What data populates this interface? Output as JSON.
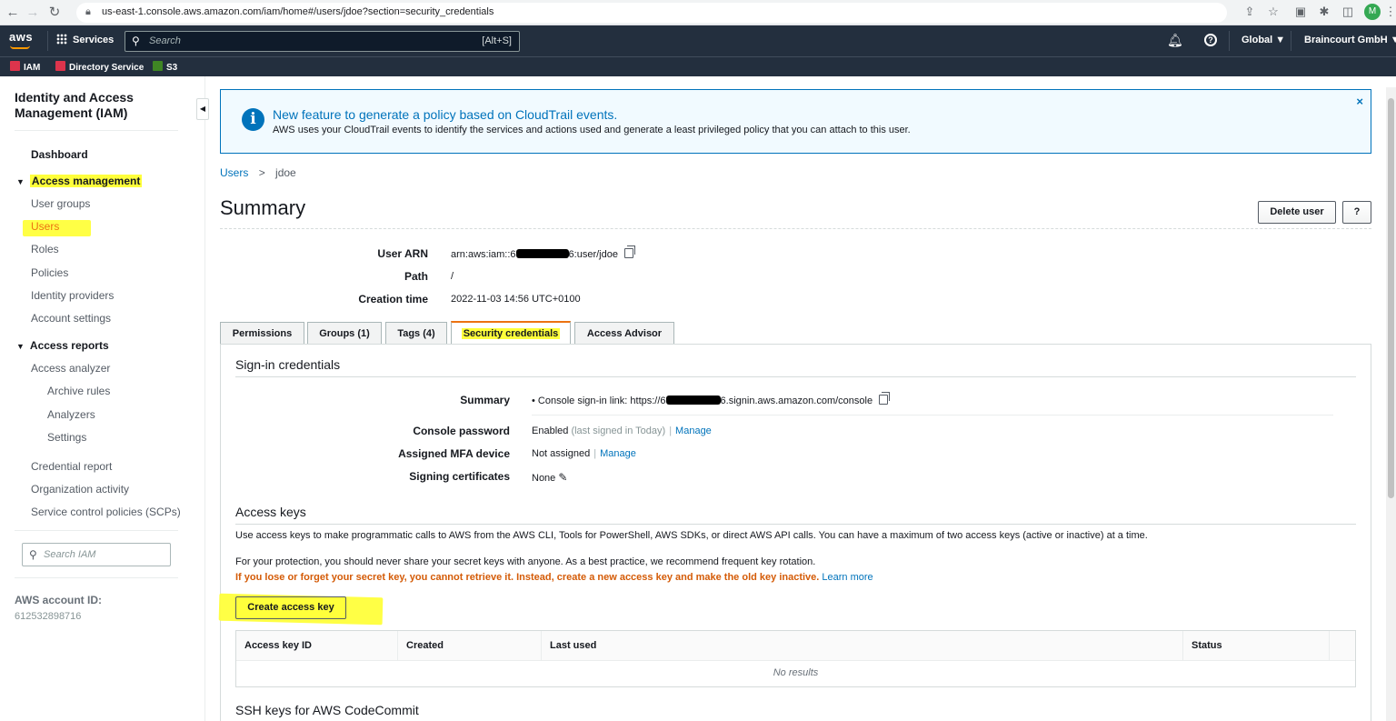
{
  "browser": {
    "url": "us-east-1.console.aws.amazon.com/iam/home#/users/jdoe?section=security_credentials",
    "profile_initial": "M"
  },
  "topnav": {
    "logo": "aws",
    "services": "Services",
    "search_placeholder": "Search",
    "search_shortcut": "[Alt+S]",
    "region": "Global ▼",
    "account": "Braincourt GmbH ▼"
  },
  "favorites": [
    {
      "label": "IAM",
      "color": "#dd344c"
    },
    {
      "label": "Directory Service",
      "color": "#dd344c"
    },
    {
      "label": "S3",
      "color": "#3f8624"
    }
  ],
  "sidebar": {
    "title": "Identity and Access Management (IAM)",
    "dashboard": "Dashboard",
    "access_management": "Access management",
    "access_items": [
      "User groups",
      "Users",
      "Roles",
      "Policies",
      "Identity providers",
      "Account settings"
    ],
    "access_reports": "Access reports",
    "access_analyzer": "Access analyzer",
    "analyzer_items": [
      "Archive rules",
      "Analyzers",
      "Settings"
    ],
    "report_items": [
      "Credential report",
      "Organization activity",
      "Service control policies (SCPs)"
    ],
    "search_placeholder": "Search IAM",
    "account_id_label": "AWS account ID:",
    "account_id": "612532898716"
  },
  "banner": {
    "title": "New feature to generate a policy based on CloudTrail events.",
    "text": "AWS uses your CloudTrail events to identify the services and actions used and generate a least privileged policy that you can attach to this user.",
    "close": "×"
  },
  "breadcrumb": {
    "users": "Users",
    "sep": ">",
    "current": "jdoe"
  },
  "page": {
    "title": "Summary",
    "delete_button": "Delete user",
    "help_button": "?"
  },
  "summary": {
    "user_arn_label": "User ARN",
    "user_arn_prefix": "arn:aws:iam::6",
    "user_arn_suffix": "6:user/jdoe",
    "path_label": "Path",
    "path": "/",
    "creation_time_label": "Creation time",
    "creation_time": "2022-11-03 14:56 UTC+0100"
  },
  "tabs": [
    "Permissions",
    "Groups (1)",
    "Tags (4)",
    "Security credentials",
    "Access Advisor"
  ],
  "signin": {
    "heading": "Sign-in credentials",
    "summary_label": "Summary",
    "console_link_prefix": "•  Console sign-in link: https://6",
    "console_link_suffix": "6.signin.aws.amazon.com/console",
    "console_password_label": "Console password",
    "console_password_value": "Enabled",
    "console_password_note": "(last signed in Today)",
    "mfa_label": "Assigned MFA device",
    "mfa_value": "Not assigned",
    "manage": "Manage",
    "signing_label": "Signing certificates",
    "signing_value": "None"
  },
  "access_keys": {
    "heading": "Access keys",
    "description": "Use access keys to make programmatic calls to AWS from the AWS CLI, Tools for PowerShell, AWS SDKs, or direct AWS API calls. You can have a maximum of two access keys (active or inactive) at a time.",
    "protection": "For your protection, you should never share your secret keys with anyone. As a best practice, we recommend frequent key rotation.",
    "warning": "If you lose or forget your secret key, you cannot retrieve it. Instead, create a new access key and make the old key inactive.",
    "learn_more": "Learn more",
    "create_button": "Create access key",
    "columns": [
      "Access key ID",
      "Created",
      "Last used",
      "Status"
    ],
    "empty": "No results"
  },
  "ssh": {
    "heading": "SSH keys for AWS CodeCommit"
  },
  "colors": {
    "highlight": "#ffff3b",
    "link": "#0073bb",
    "warning": "#d45b07",
    "nav": "#232f3e"
  }
}
